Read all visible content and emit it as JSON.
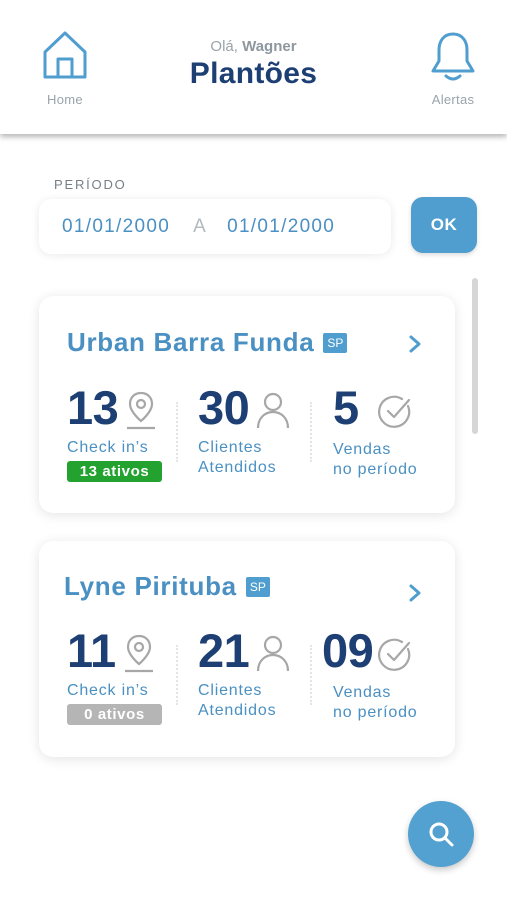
{
  "header": {
    "greeting_prefix": "Olá,",
    "user_name": "Wagner",
    "title": "Plantões",
    "home_label": "Home",
    "alerts_label": "Alertas"
  },
  "period": {
    "label": "PERÍODO",
    "from": "01/01/2000",
    "separator": "A",
    "to": "01/01/2000",
    "ok_label": "OK"
  },
  "cards": [
    {
      "name": "Urban Barra Funda",
      "state": "SP",
      "checkins": "13",
      "checkins_label": "Check in’s",
      "active_label": "13 ativos",
      "clients": "30",
      "clients_label_1": "Clientes",
      "clients_label_2": "Atendidos",
      "sales": "5",
      "sales_label_1": "Vendas",
      "sales_label_2": "no período"
    },
    {
      "name": "Lyne Pirituba",
      "state": "SP",
      "checkins": "11",
      "checkins_label": "Check in’s",
      "active_label": "0 ativos",
      "clients": "21",
      "clients_label_1": "Clientes",
      "clients_label_2": "Atendidos",
      "sales": "09",
      "sales_label_1": "Vendas",
      "sales_label_2": "no período"
    }
  ],
  "icons": {
    "home": "home-icon",
    "alerts": "bell-icon",
    "checkins": "map-pin-icon",
    "clients": "person-icon",
    "sales": "check-circle-icon",
    "chevron": "chevron-right-icon",
    "fab": "search-icon"
  },
  "colors": {
    "primary_dark": "#1d3f73",
    "primary": "#4a90c2",
    "accent": "#4f9ecf",
    "active_green": "#23a230",
    "inactive_gray": "#b5b5b5"
  }
}
